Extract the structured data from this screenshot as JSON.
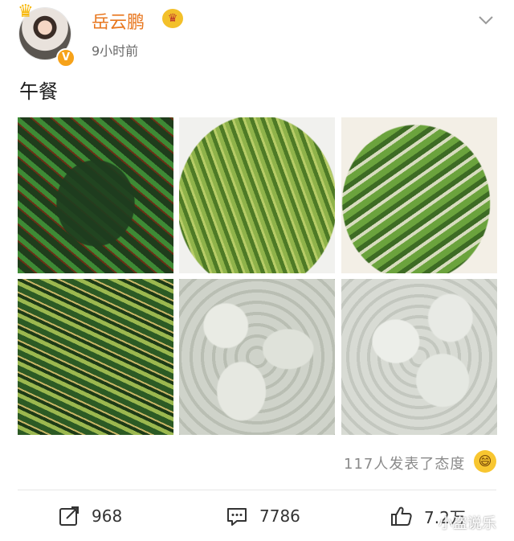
{
  "post": {
    "username": "岳云鹏",
    "timestamp": "9小时前",
    "text": "午餐",
    "verified_badge": "V",
    "images": [
      {
        "name": "photo-stir-fried-greens"
      },
      {
        "name": "photo-fern-greens"
      },
      {
        "name": "photo-lettuce"
      },
      {
        "name": "photo-cucumber-salad"
      },
      {
        "name": "photo-dumplings"
      },
      {
        "name": "photo-dumplings-2"
      }
    ]
  },
  "reactions": {
    "text": "117人发表了态度",
    "emoji": "😄"
  },
  "actions": {
    "repost_count": "968",
    "comment_count": "7786",
    "like_count": "7.2万"
  },
  "watermark": "小盗说乐",
  "colors": {
    "username": "#e8761d",
    "vip": "#f3c02a",
    "verified": "#f6a21a"
  },
  "icons": {
    "repost": "share-edit-icon",
    "comment": "comment-bubble-icon",
    "like": "thumbs-up-icon",
    "more": "chevron-down-icon"
  }
}
